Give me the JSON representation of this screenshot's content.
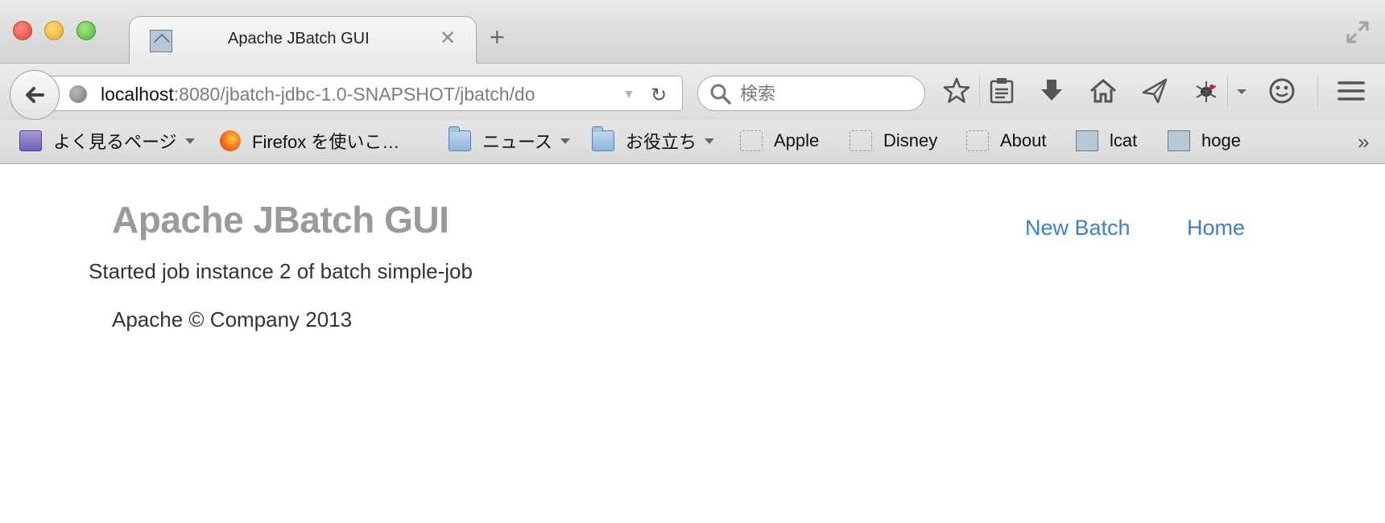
{
  "browser": {
    "tab": {
      "title": "Apache JBatch GUI",
      "close_glyph": "✕"
    },
    "new_tab_glyph": "+",
    "url": {
      "host": "localhost",
      "rest": ":8080/jbatch-jdbc-1.0-SNAPSHOT/jbatch/do"
    },
    "search": {
      "placeholder": "検索"
    },
    "toolbar_icons": [
      "bookmark-star-icon",
      "reading-list-icon",
      "download-icon",
      "home-icon",
      "send-icon",
      "extension-icon",
      "menu-dropdown-icon",
      "smiley-icon",
      "hamburger-menu-icon"
    ]
  },
  "bookmarks": [
    {
      "label": "よく見るページ",
      "icon": "smart-folder-icon",
      "caret": true
    },
    {
      "label": "Firefox を使いこ…",
      "icon": "firefox-icon",
      "caret": false
    },
    {
      "label": "ニュース",
      "icon": "folder-icon",
      "caret": true
    },
    {
      "label": "お役立ち",
      "icon": "folder-icon",
      "caret": true
    },
    {
      "label": "Apple",
      "icon": "placeholder-icon",
      "caret": false
    },
    {
      "label": "Disney",
      "icon": "placeholder-icon",
      "caret": false
    },
    {
      "label": "About",
      "icon": "placeholder-icon",
      "caret": false
    },
    {
      "label": "lcat",
      "icon": "page-icon",
      "caret": false
    },
    {
      "label": "hoge",
      "icon": "page-icon",
      "caret": false
    }
  ],
  "bookmarks_more_glyph": "»",
  "page": {
    "brand": "Apache JBatch GUI",
    "nav": [
      "New Batch",
      "Home"
    ],
    "message": "Started job instance 2 of batch simple-job",
    "footer": "Apache © Company 2013"
  },
  "colors": {
    "link": "#3a82c4",
    "brand": "#9a9a9a",
    "text": "#333333"
  }
}
